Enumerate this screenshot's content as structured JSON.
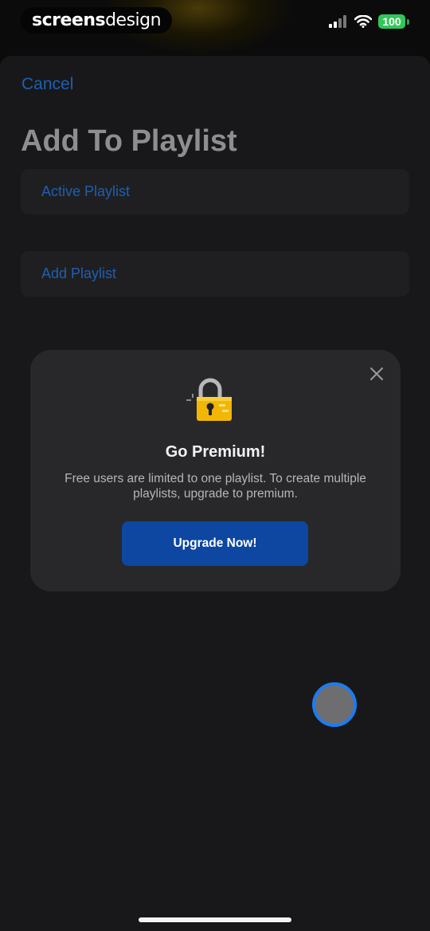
{
  "watermark": {
    "part1": "screens",
    "part2": "design"
  },
  "status_bar": {
    "battery": "100",
    "icons": [
      "signal-icon",
      "wifi-icon",
      "battery-icon"
    ]
  },
  "header": {
    "cancel_label": "Cancel",
    "title": "Add To Playlist"
  },
  "playlists": [
    {
      "label": "Active Playlist"
    },
    {
      "label": "Add Playlist"
    }
  ],
  "modal": {
    "icon": "lock-icon",
    "title": "Go Premium!",
    "message": "Free users are limited to one playlist. To create multiple playlists, upgrade to premium.",
    "button_label": "Upgrade Now!"
  },
  "colors": {
    "accent": "#1f5fb0",
    "button": "#0d47a1",
    "background": "#18181a",
    "battery": "#31c75a"
  }
}
